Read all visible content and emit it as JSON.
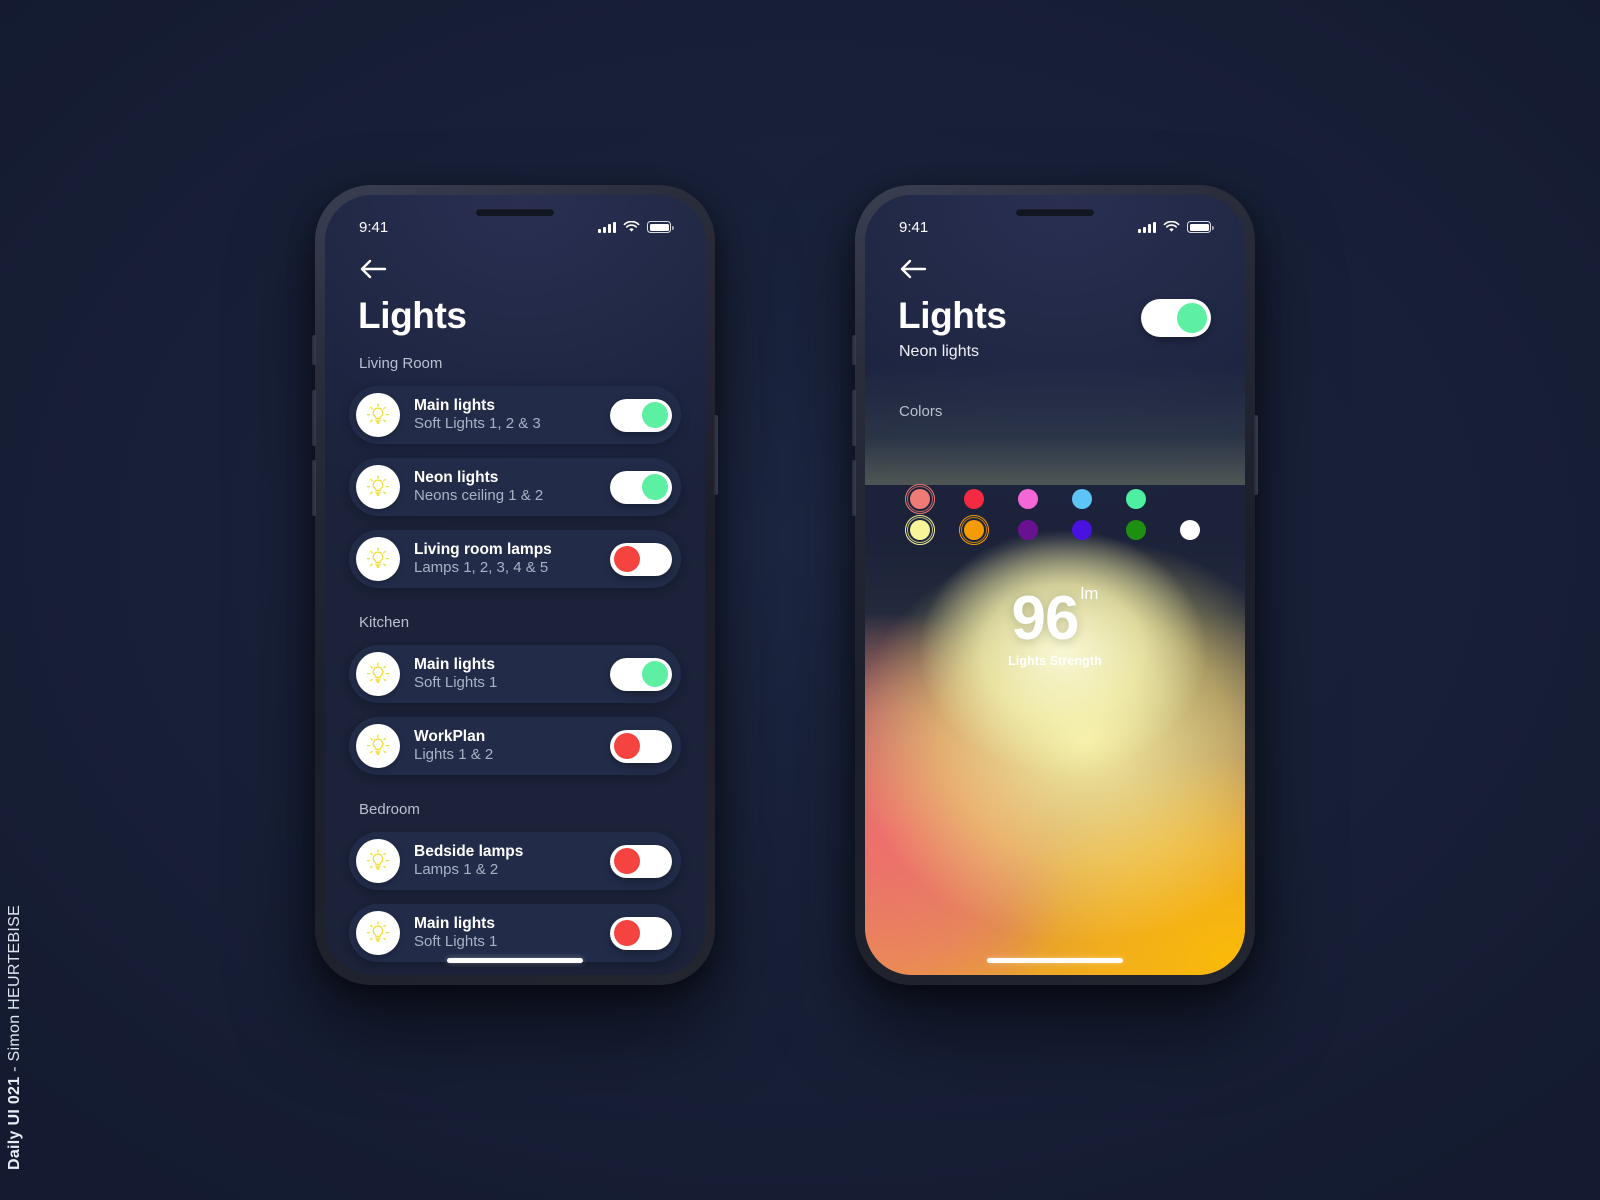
{
  "credit": {
    "bold": "Daily UI 021",
    "rest": " - Simon HEURTEBISE"
  },
  "status": {
    "time": "9:41",
    "signal_icon": "cellular-signal-icon",
    "wifi_icon": "wifi-icon",
    "battery_icon": "battery-icon"
  },
  "list_screen": {
    "back_label": "back-arrow",
    "title": "Lights",
    "groups": [
      {
        "label": "Living Room",
        "items": [
          {
            "title": "Main lights",
            "subtitle": "Soft Lights 1, 2 & 3",
            "state": "on"
          },
          {
            "title": "Neon lights",
            "subtitle": "Neons ceiling 1 & 2",
            "state": "on"
          },
          {
            "title": "Living room lamps",
            "subtitle": "Lamps 1, 2, 3, 4 & 5",
            "state": "off"
          }
        ]
      },
      {
        "label": "Kitchen",
        "items": [
          {
            "title": "Main lights",
            "subtitle": "Soft Lights 1",
            "state": "on"
          },
          {
            "title": "WorkPlan",
            "subtitle": "Lights 1 & 2",
            "state": "off"
          }
        ]
      },
      {
        "label": "Bedroom",
        "items": [
          {
            "title": "Bedside lamps",
            "subtitle": "Lamps 1 & 2",
            "state": "off"
          },
          {
            "title": "Main lights",
            "subtitle": "Soft Lights 1",
            "state": "off"
          }
        ]
      }
    ]
  },
  "detail_screen": {
    "title": "Lights",
    "subtitle": "Neon lights",
    "master_toggle_state": "on",
    "colors_label": "Colors",
    "swatch_rows": [
      [
        {
          "name": "salmon",
          "hex": "#ef7b77",
          "selected": true
        },
        {
          "name": "red",
          "hex": "#f52a42",
          "selected": false
        },
        {
          "name": "pink",
          "hex": "#f667d6",
          "selected": false
        },
        {
          "name": "sky-blue",
          "hex": "#5ec3f7",
          "selected": false
        },
        {
          "name": "mint-green",
          "hex": "#4df0a0",
          "selected": false
        }
      ],
      [
        {
          "name": "pale-yellow",
          "hex": "#f7f49a",
          "selected": true
        },
        {
          "name": "orange",
          "hex": "#f59b05",
          "selected": true
        },
        {
          "name": "purple",
          "hex": "#6a1192",
          "selected": false
        },
        {
          "name": "blue-violet",
          "hex": "#4a12e0",
          "selected": false
        },
        {
          "name": "green",
          "hex": "#1d8f13",
          "selected": false
        },
        {
          "name": "white",
          "hex": "#ffffff",
          "selected": false
        }
      ]
    ],
    "strength": {
      "value": "96",
      "unit": "lm",
      "caption": "Lights Strength"
    }
  },
  "accents": {
    "toggle_on": "#5df0a3",
    "toggle_off": "#f5443f",
    "bulb": "#f5e74f",
    "row_bg": "#222c49",
    "screen_bg": "#1d2440"
  }
}
